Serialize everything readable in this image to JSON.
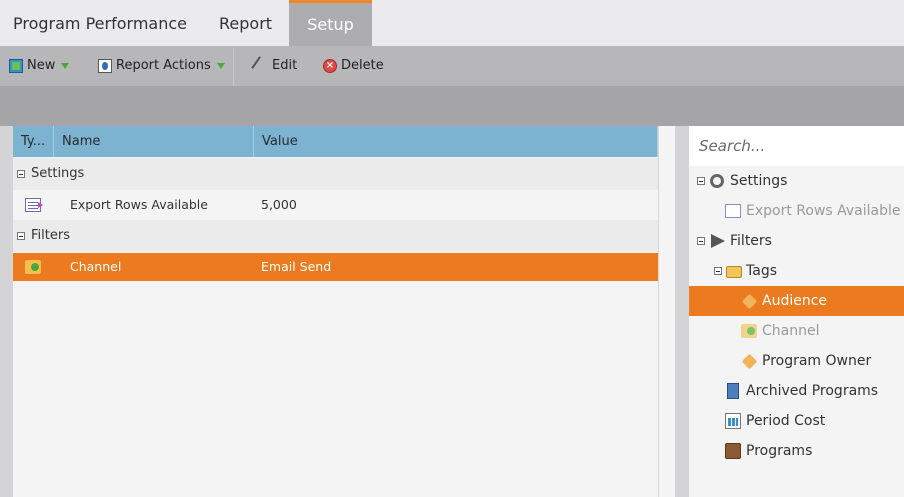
{
  "tabs": [
    {
      "label": "Program Performance",
      "active": false
    },
    {
      "label": "Report",
      "active": false
    },
    {
      "label": "Setup",
      "active": true
    }
  ],
  "toolbar": {
    "new_label": "New",
    "report_actions_label": "Report Actions",
    "edit_label": "Edit",
    "delete_label": "Delete"
  },
  "grid": {
    "columns": [
      "Ty...",
      "Name",
      "Value"
    ],
    "groups": [
      {
        "label": "Settings",
        "rows": [
          {
            "name": "Export Rows Available",
            "value": "5,000",
            "icon": "export-rows-icon"
          }
        ]
      },
      {
        "label": "Filters",
        "rows": [
          {
            "name": "Channel",
            "value": "Email Send",
            "icon": "channel-icon",
            "selected": true
          }
        ]
      }
    ]
  },
  "tree": {
    "search_placeholder": "Search...",
    "nodes": [
      {
        "label": "Settings",
        "icon": "gear-icon"
      },
      {
        "label": "Export Rows Available",
        "icon": "export-rows-icon",
        "disabled": true
      },
      {
        "label": "Filters",
        "icon": "filter-icon"
      },
      {
        "label": "Tags",
        "icon": "folder-icon"
      },
      {
        "label": "Audience",
        "icon": "tag-icon",
        "selected": true
      },
      {
        "label": "Channel",
        "icon": "channel-icon",
        "disabled": true
      },
      {
        "label": "Program Owner",
        "icon": "tag-icon"
      },
      {
        "label": "Archived Programs",
        "icon": "archive-icon"
      },
      {
        "label": "Period Cost",
        "icon": "period-cost-icon"
      },
      {
        "label": "Programs",
        "icon": "programs-icon"
      }
    ]
  },
  "colors": {
    "accent": "#ec7b1f",
    "grid_header": "#7bb3d1"
  }
}
